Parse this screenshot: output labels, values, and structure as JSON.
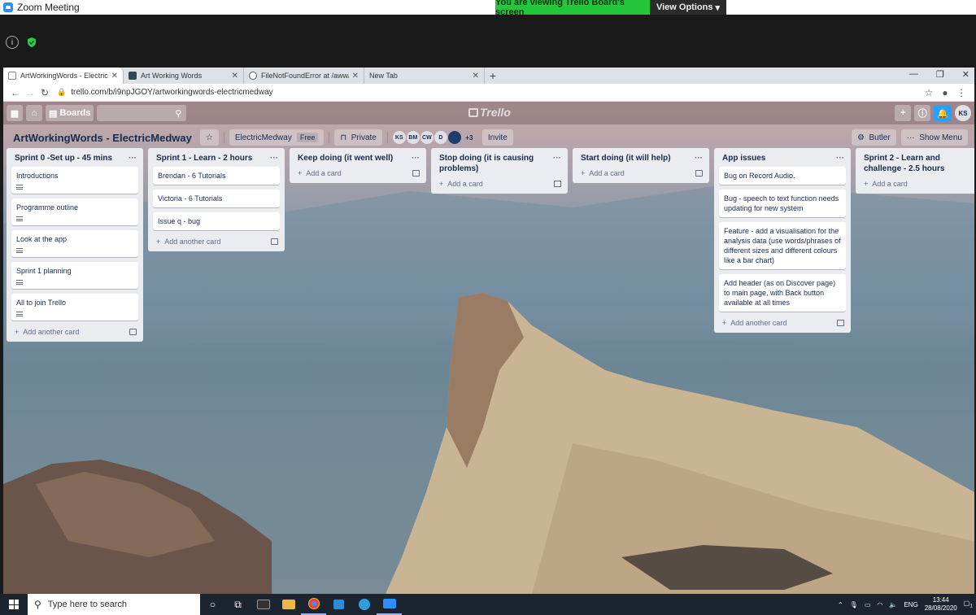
{
  "zoom": {
    "window_title": "Zoom Meeting",
    "banner_text": "You are viewing Trello Board's screen",
    "view_options": "View Options"
  },
  "browser": {
    "tabs": [
      {
        "title": "ArtWorkingWords - ElectricMedw",
        "active": true
      },
      {
        "title": "Art Working Words",
        "active": false
      },
      {
        "title": "FileNotFoundError at /aww/anel",
        "active": false
      },
      {
        "title": "New Tab",
        "active": false
      }
    ],
    "url": "trello.com/b/i9npJGOY/artworkingwords-electricmedway"
  },
  "trello": {
    "nav": {
      "boards_label": "Boards",
      "logo": "Trello",
      "user_initials": "KS"
    },
    "board": {
      "title": "ArtWorkingWords - ElectricMedway",
      "team": "ElectricMedway",
      "plan": "Free",
      "visibility": "Private",
      "members": [
        "KS",
        "BM",
        "CW",
        "D"
      ],
      "extra_members": "+3",
      "invite": "Invite",
      "butler": "Butler",
      "show_menu": "Show Menu"
    },
    "lists": [
      {
        "title": "Sprint 0 -Set up - 45 mins",
        "add": "Add another card",
        "cards": [
          {
            "text": "Introductions",
            "desc": true
          },
          {
            "text": "Programme outline",
            "desc": true
          },
          {
            "text": "Look at the app",
            "desc": true
          },
          {
            "text": "Sprint 1 planning",
            "desc": true
          },
          {
            "text": "All to join Trello",
            "desc": true
          }
        ]
      },
      {
        "title": "Sprint 1 - Learn - 2 hours",
        "add": "Add another card",
        "cards": [
          {
            "text": "Brendan - 6 Tutorials",
            "desc": false
          },
          {
            "text": "Victoria - 6 Tutorials",
            "desc": false
          },
          {
            "text": "Issue q - bug",
            "desc": false
          }
        ]
      },
      {
        "title": "Keep doing (it went well)",
        "add": "Add a card",
        "cards": []
      },
      {
        "title": "Stop doing (it is causing problems)",
        "add": "Add a card",
        "cards": []
      },
      {
        "title": "Start doing (it will help)",
        "add": "Add a card",
        "cards": []
      },
      {
        "title": "App issues",
        "add": "Add another card",
        "cards": [
          {
            "text": "Bug on Record Audio.",
            "desc": false
          },
          {
            "text": "Bug - speech to text function needs updating for new system",
            "desc": false
          },
          {
            "text": "Feature - add a visualisation for the analysis data (use words/phrases of different sizes and different colours like a bar chart)",
            "desc": false
          },
          {
            "text": "Add header (as on Discover page) to main page, with Back button available at all times",
            "desc": false
          }
        ]
      },
      {
        "title": "Sprint 2 - Learn and challenge - 2.5 hours",
        "add": "Add a card",
        "cards": []
      }
    ]
  },
  "taskbar": {
    "search_placeholder": "Type here to search",
    "language": "ENG",
    "time": "13:44",
    "date": "28/08/2020",
    "notifications": "1"
  },
  "colors": {
    "zoom_green": "#24c73c",
    "trello_list": "#ebecf0",
    "bell_blue": "#2ba1ff"
  }
}
